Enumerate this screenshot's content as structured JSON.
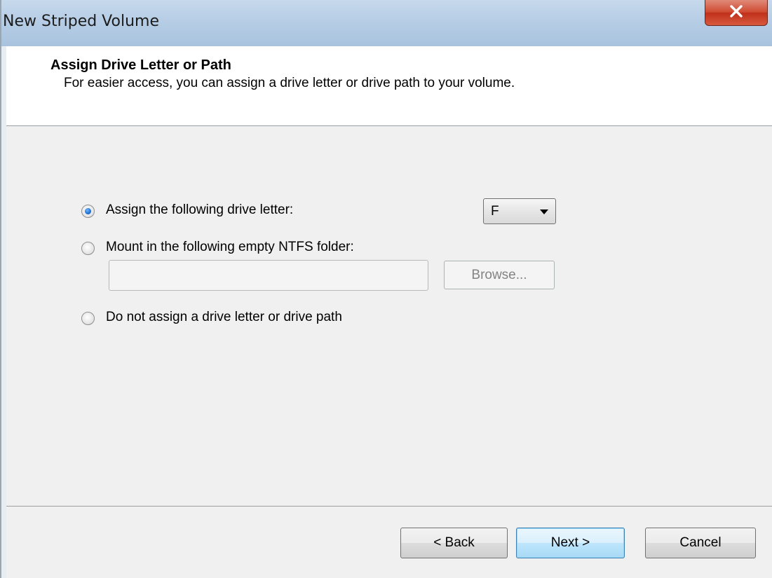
{
  "window": {
    "title": "New Striped Volume"
  },
  "header": {
    "title": "Assign Drive Letter or Path",
    "subtitle": "For easier access, you can assign a drive letter or drive path to your volume."
  },
  "options": {
    "assign_letter_label": "Assign the following drive letter:",
    "mount_folder_label": "Mount in the following empty NTFS folder:",
    "no_assign_label": "Do not assign a drive letter or drive path",
    "selected": "assign_letter",
    "drive_letter_value": "F",
    "folder_path_value": "",
    "browse_label": "Browse..."
  },
  "footer": {
    "back_label": "< Back",
    "next_label": "Next >",
    "cancel_label": "Cancel"
  },
  "icons": {
    "close": "close-icon",
    "dropdown": "chevron-down-icon"
  },
  "colors": {
    "close_button": "#c7412b",
    "default_button_border": "#3c7fb1",
    "radio_dot": "#1c6fd1"
  }
}
